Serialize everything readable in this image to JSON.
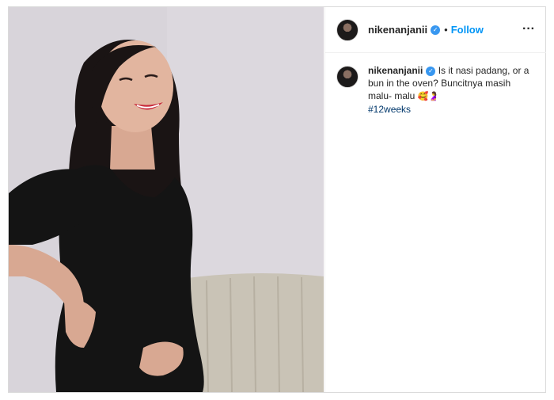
{
  "header": {
    "username": "nikenanjanii",
    "separator": "•",
    "follow_label": "Follow",
    "more_label": "···"
  },
  "post": {
    "username": "nikenanjanii",
    "caption": "Is it nasi padang, or a bun in the oven? Buncitnya masih malu- malu",
    "emojis": "🥰🤰",
    "hashtag": "#12weeks"
  },
  "colors": {
    "accent": "#0095f6",
    "verified": "#3897f0",
    "hashtag": "#00376b",
    "border": "#dbdbdb"
  },
  "icons": {
    "verified": "verified-badge-icon",
    "more": "more-options-icon"
  }
}
